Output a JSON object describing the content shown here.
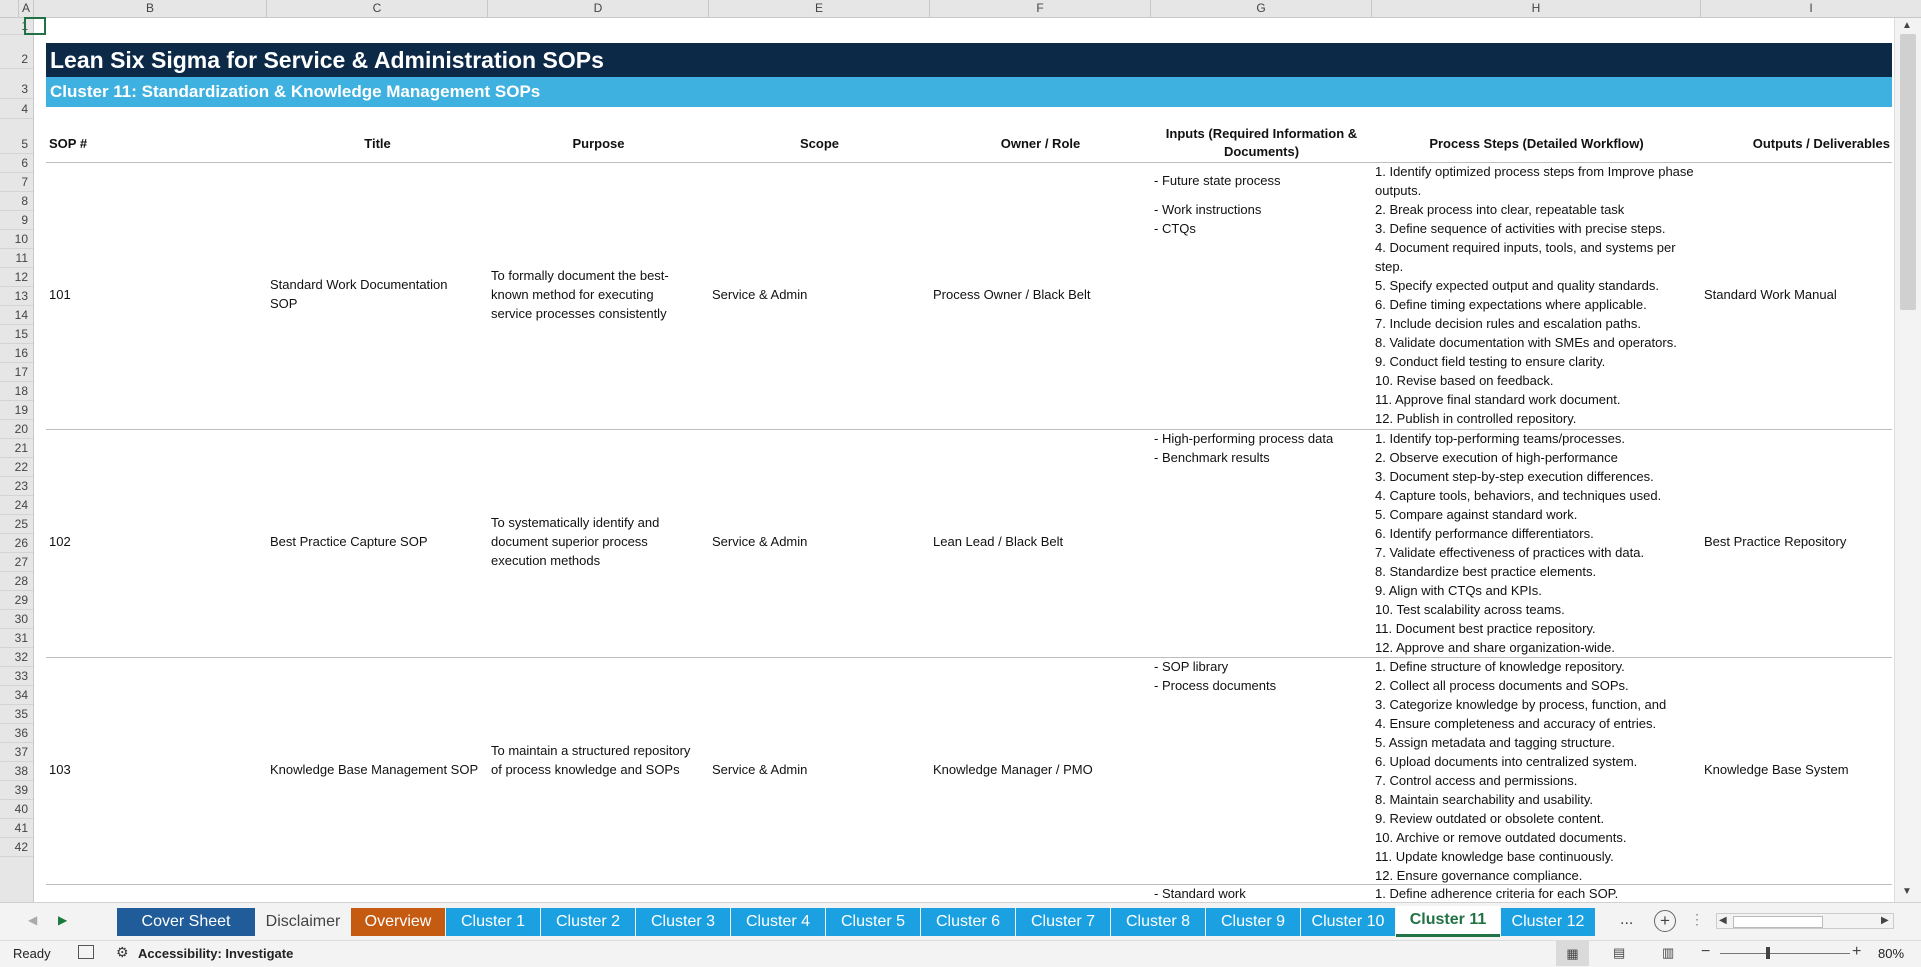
{
  "columns": [
    "A",
    "B",
    "C",
    "D",
    "E",
    "F",
    "G",
    "H",
    "I"
  ],
  "rows": [
    "1",
    "2",
    "3",
    "4",
    "5",
    "6",
    "7",
    "8",
    "9",
    "10",
    "11",
    "12",
    "13",
    "14",
    "15",
    "16",
    "17",
    "18",
    "19",
    "20",
    "21",
    "22",
    "23",
    "24",
    "25",
    "26",
    "27",
    "28",
    "29",
    "30",
    "31",
    "32",
    "33",
    "34",
    "35",
    "36",
    "37",
    "38",
    "39",
    "40",
    "41",
    "42"
  ],
  "sheet": {
    "title": "Lean Six Sigma for Service & Administration SOPs",
    "subtitle": "Cluster 11: Standardization & Knowledge Management SOPs",
    "headers": {
      "sop": "SOP #",
      "title": "Title",
      "purpose": "Purpose",
      "scope": "Scope",
      "owner": "Owner / Role",
      "inputs": "Inputs (Required Information & Documents)",
      "steps": "Process Steps (Detailed Workflow)",
      "outputs": "Outputs / Deliverables"
    },
    "sops": [
      {
        "num": "101",
        "title": "Standard Work Documentation SOP",
        "purpose": "To formally document the best-known method for executing service processes consistently",
        "scope": "Service & Admin",
        "owner": "Process Owner / Black Belt",
        "inputs": [
          "- Future state process",
          "- Work instructions",
          "- CTQs"
        ],
        "steps": [
          "1. Identify optimized process steps from Improve phase outputs.",
          "2. Break process into clear, repeatable task",
          "3. Define sequence of activities with precise steps.",
          "4. Document required inputs, tools, and systems per step.",
          "5. Specify expected output and quality standards.",
          "6. Define timing expectations where applicable.",
          "7. Include decision rules and escalation paths.",
          "8. Validate documentation with SMEs and operators.",
          "9. Conduct field testing to ensure clarity.",
          "10. Revise based on feedback.",
          "11. Approve final standard work document.",
          "12. Publish in controlled repository."
        ],
        "outputs": "Standard Work Manual"
      },
      {
        "num": "102",
        "title": "Best Practice Capture SOP",
        "purpose": "To systematically identify and document superior process execution methods",
        "scope": "Service & Admin",
        "owner": "Lean Lead / Black Belt",
        "inputs": [
          "- High-performing process data",
          "- Benchmark results"
        ],
        "steps": [
          "1. Identify top-performing teams/processes.",
          "2. Observe execution of high-performance",
          "3. Document step-by-step execution differences.",
          "4. Capture tools, behaviors, and techniques used.",
          "5. Compare against standard work.",
          "6. Identify performance differentiators.",
          "7. Validate effectiveness of practices with data.",
          "8. Standardize best practice elements.",
          "9. Align with CTQs and KPIs.",
          "10. Test scalability across teams.",
          "11. Document best practice repository.",
          "12. Approve and share organization-wide."
        ],
        "outputs": "Best Practice Repository"
      },
      {
        "num": "103",
        "title": "Knowledge Base Management SOP",
        "purpose": "To maintain a structured repository of process knowledge and SOPs",
        "scope": "Service & Admin",
        "owner": "Knowledge Manager / PMO",
        "inputs": [
          "- SOP library",
          "- Process documents"
        ],
        "steps": [
          "1. Define structure of knowledge repository.",
          "2. Collect all process documents and SOPs.",
          "3. Categorize knowledge by process, function, and",
          "4. Ensure completeness and accuracy of entries.",
          "5. Assign metadata and tagging structure.",
          "6. Upload documents into centralized system.",
          "7. Control access and permissions.",
          "8. Maintain searchability and usability.",
          "9. Review outdated or obsolete content.",
          "10. Archive or remove outdated documents.",
          "11. Update knowledge base continuously.",
          "12. Ensure governance compliance."
        ],
        "outputs": "Knowledge Base System"
      },
      {
        "inputs": [
          "- Standard work"
        ],
        "steps": [
          "1. Define adherence criteria for each SOP."
        ]
      }
    ]
  },
  "tabs": [
    {
      "label": "Cover Sheet",
      "color": "#1f5c99",
      "text": "#ffffff",
      "active": false
    },
    {
      "label": "Disclaimer",
      "color": "#f3f3f3",
      "text": "#444444",
      "active": false
    },
    {
      "label": "Overview",
      "color": "#c55a11",
      "text": "#ffffff",
      "active": false
    },
    {
      "label": "Cluster 1",
      "color": "#1ba1e2",
      "text": "#ffffff",
      "active": false
    },
    {
      "label": "Cluster 2",
      "color": "#1ba1e2",
      "text": "#ffffff",
      "active": false
    },
    {
      "label": "Cluster 3",
      "color": "#1ba1e2",
      "text": "#ffffff",
      "active": false
    },
    {
      "label": "Cluster 4",
      "color": "#1ba1e2",
      "text": "#ffffff",
      "active": false
    },
    {
      "label": "Cluster 5",
      "color": "#1ba1e2",
      "text": "#ffffff",
      "active": false
    },
    {
      "label": "Cluster 6",
      "color": "#1ba1e2",
      "text": "#ffffff",
      "active": false
    },
    {
      "label": "Cluster 7",
      "color": "#1ba1e2",
      "text": "#ffffff",
      "active": false
    },
    {
      "label": "Cluster 8",
      "color": "#1ba1e2",
      "text": "#ffffff",
      "active": false
    },
    {
      "label": "Cluster 9",
      "color": "#1ba1e2",
      "text": "#ffffff",
      "active": false
    },
    {
      "label": "Cluster 10",
      "color": "#1ba1e2",
      "text": "#ffffff",
      "active": false
    },
    {
      "label": "Cluster 11",
      "color": "#ffffff",
      "text": "#217346",
      "active": true
    },
    {
      "label": "Cluster 12",
      "color": "#1ba1e2",
      "text": "#ffffff",
      "active": false
    }
  ],
  "tab_more": "...",
  "status": {
    "ready": "Ready",
    "accessibility": "Accessibility: Investigate",
    "zoom": "80%"
  },
  "colors": {
    "title_bg": "#0c2948",
    "subtitle_bg": "#3fb1e0",
    "excel_green": "#217346"
  }
}
